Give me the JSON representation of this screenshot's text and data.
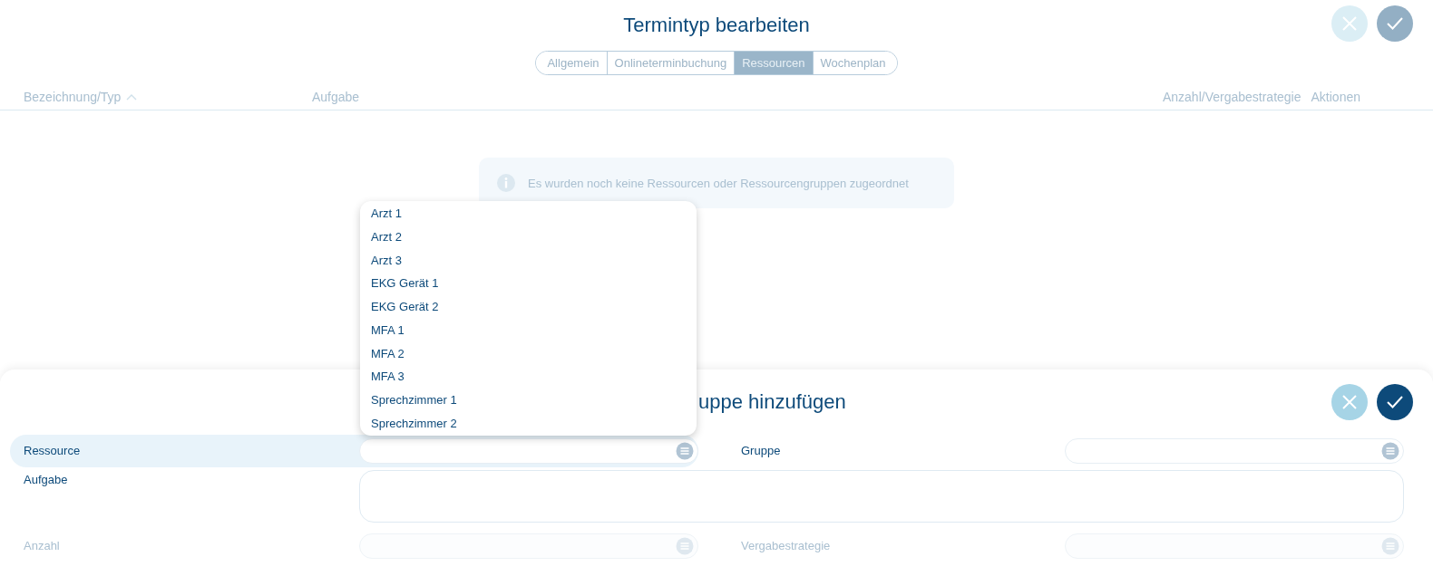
{
  "title": "Termintyp bearbeiten",
  "header_buttons": [
    {
      "kind": "cancel",
      "disabled": true
    },
    {
      "kind": "confirm",
      "disabled": true
    }
  ],
  "tabs": [
    {
      "label": "Allgemein",
      "selected": false
    },
    {
      "label": "Onlineterminbuchung",
      "selected": false
    },
    {
      "label": "Ressourcen",
      "selected": true
    },
    {
      "label": "Wochenplan",
      "selected": false
    }
  ],
  "table": {
    "columns": [
      {
        "label": "Bezeichnung/Typ",
        "sorted": true
      },
      {
        "label": "Aufgabe",
        "sorted": false
      },
      {
        "label": "Anzahl/Vergabestrategie",
        "sorted": false
      },
      {
        "label": "Aktionen",
        "sorted": false
      }
    ],
    "empty_message": "Es wurden noch keine Ressourcen oder Ressourcengruppen zugeordnet"
  },
  "panel": {
    "title": "uppe hinzufügen",
    "buttons": [
      {
        "kind": "cancel",
        "disabled": false
      },
      {
        "kind": "confirm",
        "disabled": false
      }
    ],
    "rows": [
      {
        "fields": [
          {
            "label": "Ressource",
            "kind": "select",
            "selected": true,
            "disabled": false
          },
          {
            "label": "Gruppe",
            "kind": "select",
            "selected": false,
            "disabled": false
          }
        ]
      },
      {
        "fields": [
          {
            "label": "Aufgabe",
            "kind": "textarea",
            "selected": false,
            "disabled": false
          }
        ]
      },
      {
        "fields": [
          {
            "label": "Anzahl",
            "kind": "select",
            "selected": false,
            "disabled": true
          },
          {
            "label": "Vergabestrategie",
            "kind": "select",
            "selected": false,
            "disabled": true
          }
        ]
      }
    ]
  },
  "dropdown": {
    "options": [
      "Arzt 1",
      "Arzt 2",
      "Arzt 3",
      "EKG Gerät 1",
      "EKG Gerät 2",
      "MFA 1",
      "MFA 2",
      "MFA 3",
      "Sprechzimmer 1",
      "Sprechzimmer 2"
    ]
  }
}
